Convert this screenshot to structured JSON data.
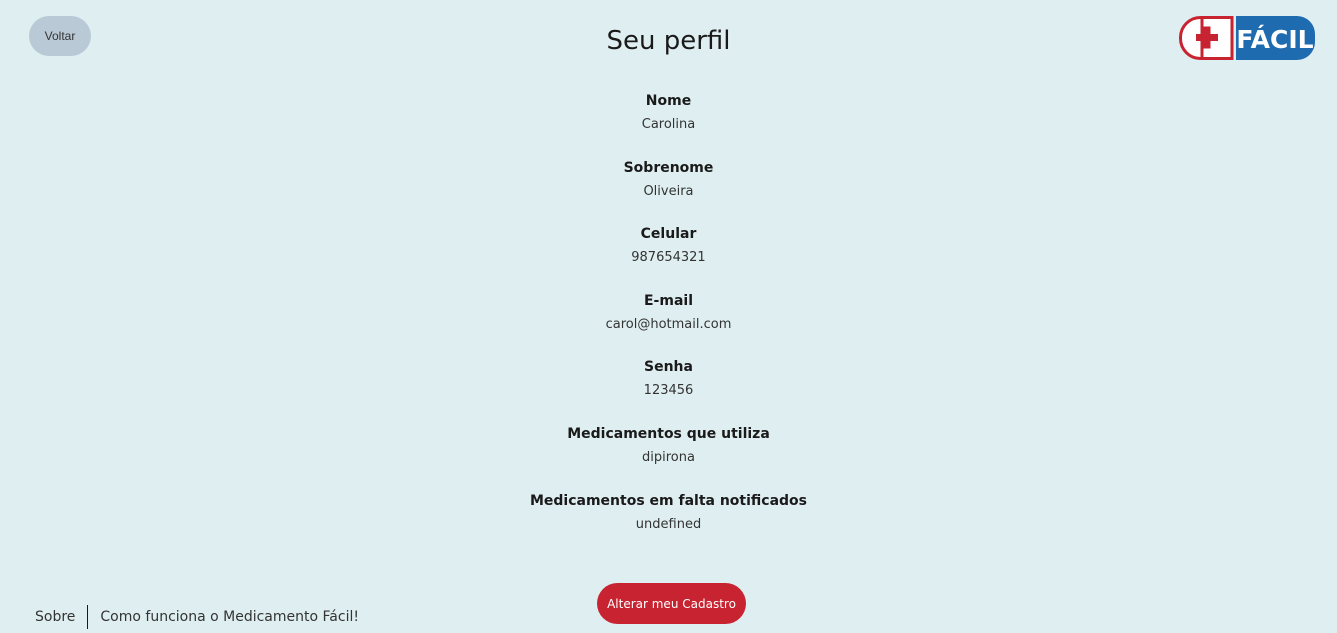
{
  "header": {
    "back_label": "Voltar",
    "title": "Seu perfil",
    "logo_text": "FÁCIL"
  },
  "profile": {
    "fields": [
      {
        "label": "Nome",
        "value": "Carolina"
      },
      {
        "label": "Sobrenome",
        "value": "Oliveira"
      },
      {
        "label": "Celular",
        "value": "987654321"
      },
      {
        "label": "E-mail",
        "value": "carol@hotmail.com"
      },
      {
        "label": "Senha",
        "value": "123456"
      },
      {
        "label": "Medicamentos que utiliza",
        "value": "dipirona"
      },
      {
        "label": "Medicamentos em falta notificados",
        "value": "undefined"
      }
    ]
  },
  "actions": {
    "edit_label": "Alterar meu Cadastro"
  },
  "footer": {
    "links": [
      "Sobre",
      "Como funciona o Medicamento Fácil!"
    ]
  },
  "colors": {
    "background": "#dfeff1",
    "accent_red": "#c72330",
    "logo_blue": "#1e6bb0",
    "back_button": "#b9cad6"
  }
}
